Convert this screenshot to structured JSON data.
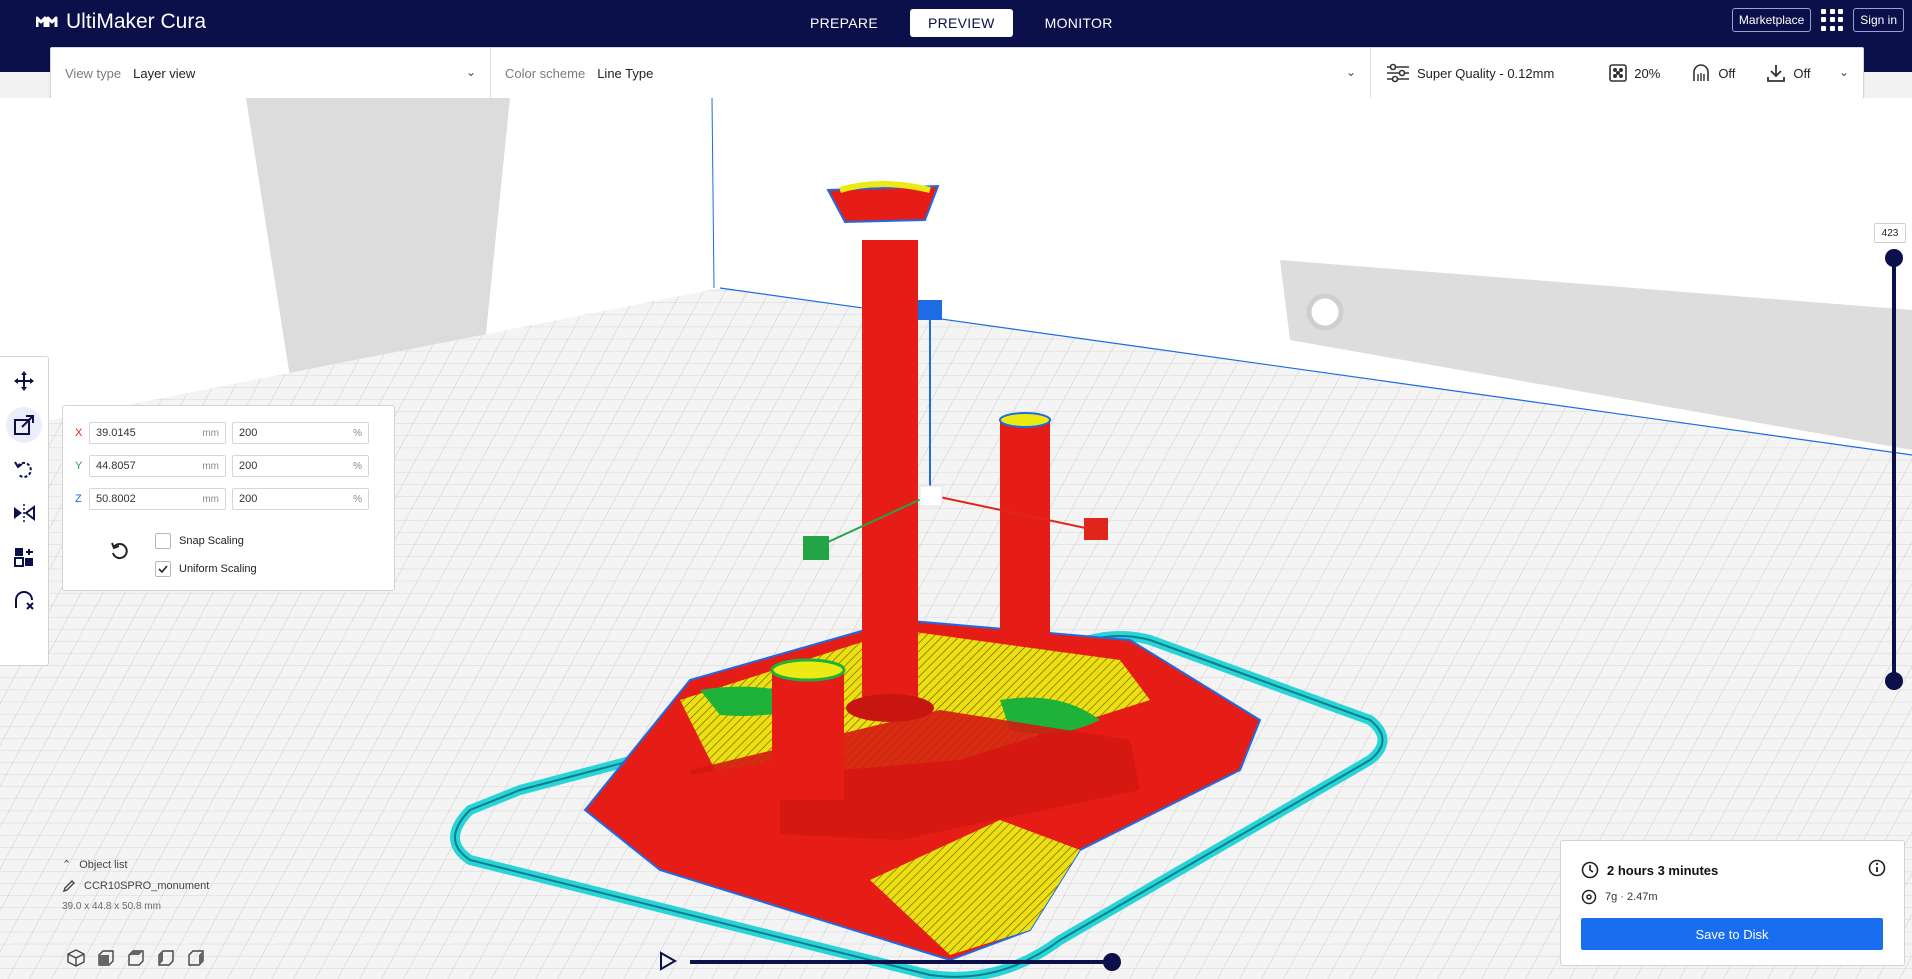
{
  "app": {
    "title": "UltiMaker Cura"
  },
  "stages": [
    "PREPARE",
    "PREVIEW",
    "MONITOR"
  ],
  "active_stage": "PREVIEW",
  "top_right": {
    "marketplace": "Marketplace",
    "signin": "Sign in"
  },
  "settings_bar": {
    "view_type_label": "View type",
    "view_type_value": "Layer view",
    "color_scheme_label": "Color scheme",
    "color_scheme_value": "Line Type",
    "profile": "Super Quality - 0.12mm",
    "infill": "20%",
    "support": "Off",
    "adhesion": "Off"
  },
  "scale_tool": {
    "x": {
      "label": "X",
      "mm": "39.0145",
      "unit_mm": "mm",
      "percent": "200",
      "unit_pct": "%"
    },
    "y": {
      "label": "Y",
      "mm": "44.8057",
      "unit_mm": "mm",
      "percent": "200",
      "unit_pct": "%"
    },
    "z": {
      "label": "Z",
      "mm": "50.8002",
      "unit_mm": "mm",
      "percent": "200",
      "unit_pct": "%"
    },
    "snap_scaling": {
      "label": "Snap Scaling",
      "checked": false
    },
    "uniform_scaling": {
      "label": "Uniform Scaling",
      "checked": true
    },
    "axis_colors": {
      "x": "#e0261a",
      "y": "#23a446",
      "z": "#1e6be6"
    }
  },
  "layer_slider": {
    "value": "423"
  },
  "object_list": {
    "title": "Object list",
    "object_name": "CCR10SPRO_monument",
    "dimensions": "39.0 x 44.8 x 50.8 mm"
  },
  "print_summary": {
    "time": "2 hours 3 minutes",
    "material": "7g · 2.47m",
    "save_button": "Save to Disk"
  },
  "colors": {
    "header": "#0b0f4a",
    "accent": "#196ef0",
    "model_red": "#e51d16",
    "infill_yellow": "#ecea12",
    "skin_green": "#1eb23a",
    "wall_blue": "#1e6be6",
    "skirt_cyan": "#28d4d8"
  }
}
